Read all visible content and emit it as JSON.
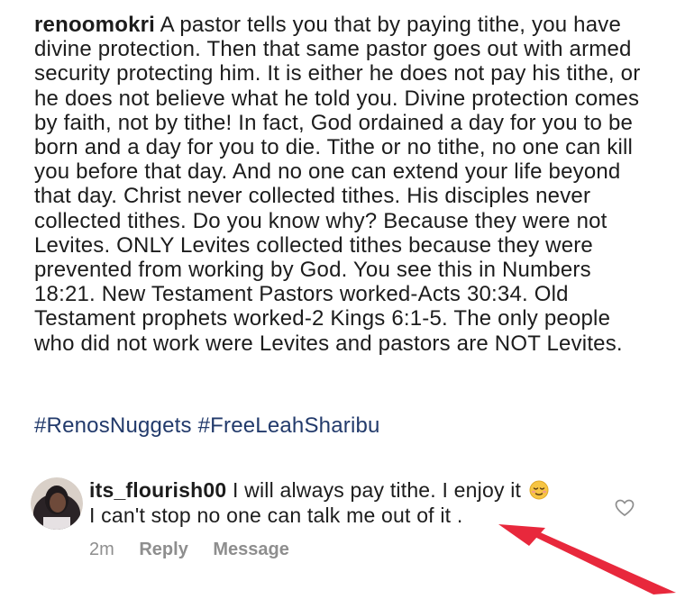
{
  "post": {
    "username": "renoomokri",
    "caption": "A pastor tells you that by paying tithe, you have divine protection. Then that same pastor goes out with armed security protecting him. It is either he does not pay his tithe, or he does not believe what he told you. Divine protection comes by faith, not by tithe! In fact, God ordained a day for you to be born and a day for you to die. Tithe or no tithe, no one can kill you before that day. And no one can extend your life beyond that day. Christ never collected tithes. His disciples never collected tithes. Do you know why? Because they were not Levites. ONLY Levites collected tithes because they were prevented from working by God. You see this in Numbers 18:21. New Testament Pastors worked-Acts 30:34. Old Testament prophets worked-2 Kings 6:1-5. The only people who did not work were Levites and pastors are NOT Levites.",
    "hashtags": [
      "#RenosNuggets",
      "#FreeLeahSharibu"
    ]
  },
  "comment": {
    "username": "its_flourish00",
    "text_line1": "I will always pay tithe. I enjoy it",
    "text_line2": "I can't stop no one can talk me out of it .",
    "time": "2m",
    "reply_label": "Reply",
    "message_label": "Message",
    "emoji_icon": "relieved-face-emoji",
    "like_icon": "heart-outline-icon"
  },
  "annotation": {
    "arrow_color": "#e8283c",
    "arrow_icon": "red-pointer-arrow"
  }
}
